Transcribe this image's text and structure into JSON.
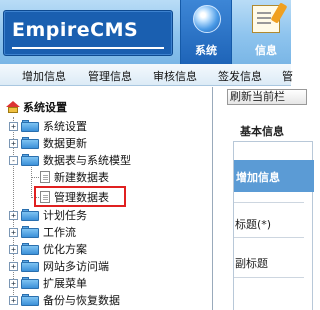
{
  "header": {
    "logo_text": "EmpireCMS",
    "tabs": [
      {
        "label": "系统",
        "icon": "globe-icon",
        "active": true
      },
      {
        "label": "信息",
        "icon": "document-edit-icon",
        "active": false
      }
    ]
  },
  "menubar": {
    "items": [
      "增加信息",
      "管理信息",
      "审核信息",
      "签发信息",
      "管"
    ]
  },
  "tree": {
    "root": "系统设置",
    "items": [
      {
        "label": "系统设置",
        "toggle": "+"
      },
      {
        "label": "数据更新",
        "toggle": "+"
      },
      {
        "label": "数据表与系统模型",
        "toggle": "-"
      },
      {
        "label": "新建数据表",
        "child": true
      },
      {
        "label": "管理数据表",
        "child": true,
        "selected": true
      },
      {
        "label": "计划任务",
        "toggle": "+"
      },
      {
        "label": "工作流",
        "toggle": "+"
      },
      {
        "label": "优化方案",
        "toggle": "+"
      },
      {
        "label": "网站多访问端",
        "toggle": "+"
      },
      {
        "label": "扩展菜单",
        "toggle": "+"
      },
      {
        "label": "备份与恢复数据",
        "toggle": "+"
      }
    ]
  },
  "right": {
    "refresh_label": "刷新当前栏",
    "section_title": "基本信息",
    "add_info_label": "增加信息",
    "fields": [
      "标题(*)",
      "副标题"
    ]
  },
  "colors": {
    "header_top": "#b9dcf6",
    "logo_bg": "#1a5fb0",
    "selection_border": "#e02020",
    "add_info_bar": "#5b9bd5"
  }
}
